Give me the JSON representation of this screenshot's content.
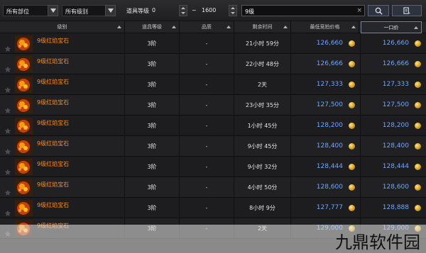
{
  "filters": {
    "position_select": "所有部位",
    "level_select": "所有级别",
    "item_level_label": "道具等级",
    "level_min": "0",
    "level_sep": "~",
    "level_max": "1600",
    "search_value": "9级",
    "clear_icon": "×",
    "search_icon": "search-icon",
    "settings_icon": "list-settings-icon"
  },
  "columns": {
    "level": "级别",
    "item_level": "道具等级",
    "quality": "品质",
    "remaining_time": "剩余时间",
    "min_bid": "最低竞拍价格",
    "buyout": "一口价"
  },
  "rows": [
    {
      "name": "9级红焰宝石",
      "item_level": "3阶",
      "quality": "-",
      "time": "21小时 59分",
      "bid": "126,660",
      "buyout": "126,660"
    },
    {
      "name": "9级红焰宝石",
      "item_level": "3阶",
      "quality": "-",
      "time": "22小时 48分",
      "bid": "126,666",
      "buyout": "126,666"
    },
    {
      "name": "9级红焰宝石",
      "item_level": "3阶",
      "quality": "-",
      "time": "2天",
      "bid": "127,333",
      "buyout": "127,333"
    },
    {
      "name": "9级红焰宝石",
      "item_level": "3阶",
      "quality": "-",
      "time": "23小时 35分",
      "bid": "127,500",
      "buyout": "127,500"
    },
    {
      "name": "9级红焰宝石",
      "item_level": "3阶",
      "quality": "-",
      "time": "1小时 45分",
      "bid": "128,200",
      "buyout": "128,200"
    },
    {
      "name": "9级红焰宝石",
      "item_level": "3阶",
      "quality": "-",
      "time": "9小时 45分",
      "bid": "128,400",
      "buyout": "128,400"
    },
    {
      "name": "9级红焰宝石",
      "item_level": "3阶",
      "quality": "-",
      "time": "9小时 32分",
      "bid": "128,444",
      "buyout": "128,444"
    },
    {
      "name": "9级红焰宝石",
      "item_level": "3阶",
      "quality": "-",
      "time": "4小时 50分",
      "bid": "128,600",
      "buyout": "128,600"
    },
    {
      "name": "9级红焰宝石",
      "item_level": "3阶",
      "quality": "-",
      "time": "8小时 9分",
      "bid": "127,777",
      "buyout": "128,888"
    },
    {
      "name": "9级红焰宝石",
      "item_level": "3阶",
      "quality": "-",
      "time": "2天",
      "bid": "129,000",
      "buyout": "129,000"
    }
  ],
  "watermark": "九鼎软件园",
  "colors": {
    "item_name": "#ff8a20",
    "price": "#6fa6ff",
    "coin": "#d19a1a"
  }
}
